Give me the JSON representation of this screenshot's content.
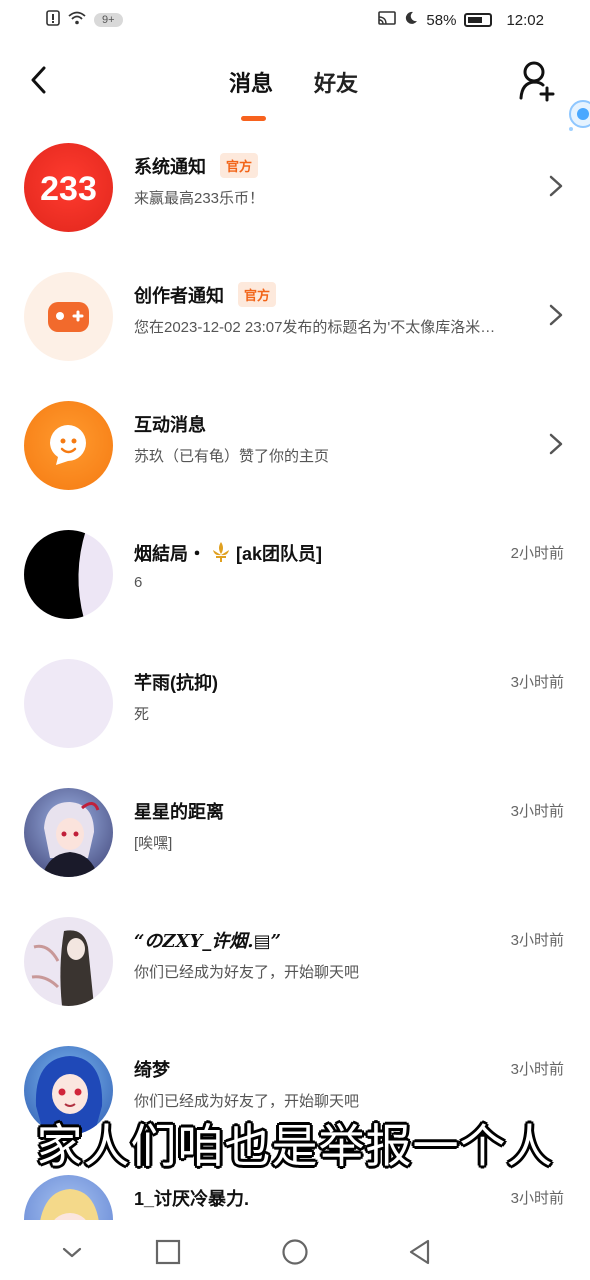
{
  "status_bar": {
    "badge": "9+",
    "battery": "58%",
    "time": "12:02"
  },
  "header": {
    "tabs": [
      {
        "label": "消息",
        "active": true
      },
      {
        "label": "好友",
        "active": false
      }
    ],
    "accent_color": "#f7621e"
  },
  "conversations": [
    {
      "name": "系统通知",
      "tag": "官方",
      "preview": "来赢最高233乐币！",
      "time": "",
      "avatar": "233-logo-icon"
    },
    {
      "name": "创作者通知",
      "tag": "官方",
      "preview": "您在2023-12-02 23:07发布的标题名为'不太像库洛米…",
      "time": "",
      "avatar": "gamepad-icon"
    },
    {
      "name": "互动消息",
      "tag": "",
      "preview": "苏玖（已有龟）赞了你的主页",
      "time": "",
      "avatar": "chat-bubble-icon"
    },
    {
      "name_before": "烟結局・",
      "name_after": "[ak团队员]",
      "preview": "6",
      "time": "2小时前",
      "avatar": "black-moon-avatar"
    },
    {
      "name": "芊雨(抗抑)",
      "preview": "死",
      "time": "3小时前",
      "avatar": "blank-avatar"
    },
    {
      "name": "星星的距离",
      "preview": "[唉嘿]",
      "time": "3小时前",
      "avatar": "anime-girl-avatar"
    },
    {
      "name": "“のZXY_许烟.▤”",
      "preview": "你们已经成为好友了，开始聊天吧",
      "time": "3小时前",
      "avatar": "sketch-girl-avatar"
    },
    {
      "name": "绮梦",
      "preview": "你们已经成为好友了，开始聊天吧",
      "time": "3小时前",
      "avatar": "blue-hair-avatar"
    },
    {
      "name": "1_讨厌冷暴力.",
      "preview": "",
      "time": "3小时前",
      "avatar": "blonde-avatar"
    }
  ],
  "subtitle": "家人们咱也是举报一个人"
}
